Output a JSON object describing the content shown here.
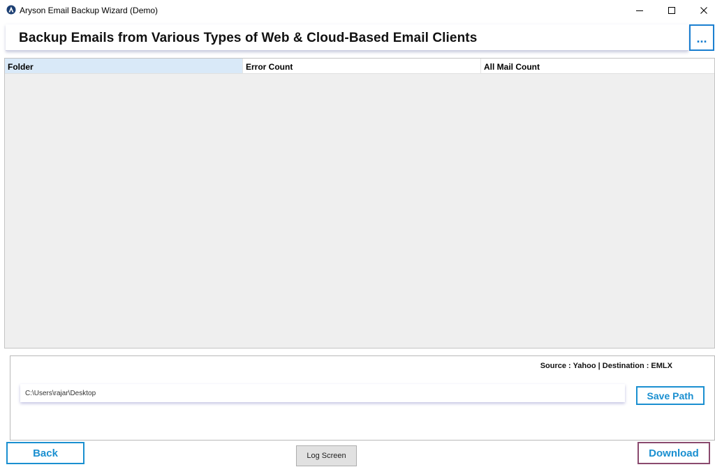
{
  "window": {
    "title": "Aryson Email Backup Wizard (Demo)",
    "app_icon": "aryson-logo-icon",
    "controls": [
      "minimize-icon",
      "maximize-icon",
      "close-icon"
    ]
  },
  "header": {
    "title": "Backup Emails from Various Types of Web & Cloud-Based Email Clients",
    "more_label": "..."
  },
  "grid": {
    "columns": [
      "Folder",
      "Error Count",
      "All Mail Count"
    ],
    "rows": []
  },
  "panel": {
    "source_destination": "Source : Yahoo | Destination : EMLX",
    "path_value": "C:\\Users\\rajar\\Desktop",
    "save_path_label": "Save Path"
  },
  "footer": {
    "back_label": "Back",
    "log_label": "Log Screen",
    "download_label": "Download"
  },
  "colors": {
    "accent": "#1a8fd0",
    "download_border": "#8a4a6e",
    "grid_bg": "#efefef",
    "folder_header_bg": "#d9e9f8"
  }
}
